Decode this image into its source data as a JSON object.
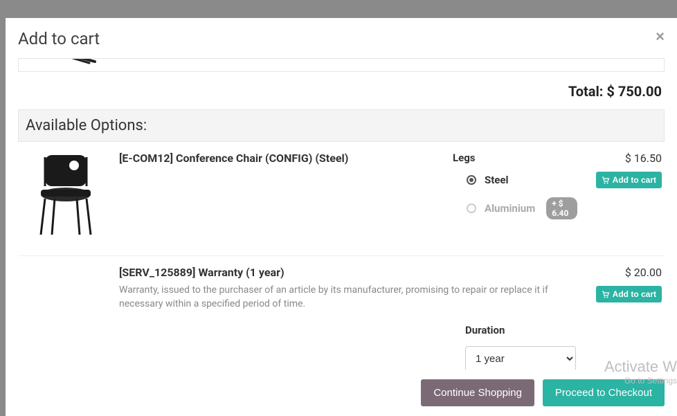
{
  "modal": {
    "title": "Add to cart",
    "close_label": "×",
    "total_label": "Total:",
    "total_value": "$ 750.00",
    "options_header": "Available Options:",
    "continue_label": "Continue Shopping",
    "checkout_label": "Proceed to Checkout"
  },
  "options": [
    {
      "title": "[E-COM12] Conference Chair (CONFIG) (Steel)",
      "description": "",
      "config_label": "Legs",
      "choices": [
        {
          "label": "Steel",
          "selected": true,
          "surcharge": ""
        },
        {
          "label": "Aluminium",
          "selected": false,
          "surcharge": "+ $ 6.40"
        }
      ],
      "price": "$ 16.50",
      "add_label": "Add to cart"
    },
    {
      "title": "[SERV_125889] Warranty (1 year)",
      "description": "Warranty, issued to the purchaser of an article by its manufacturer, promising to repair or replace it if necessary within a specified period of time.",
      "duration_label": "Duration",
      "duration_value": "1 year",
      "price": "$ 20.00",
      "add_label": "Add to cart"
    }
  ],
  "watermark": {
    "line1": "Activate W",
    "line2": "Go to Settings"
  }
}
